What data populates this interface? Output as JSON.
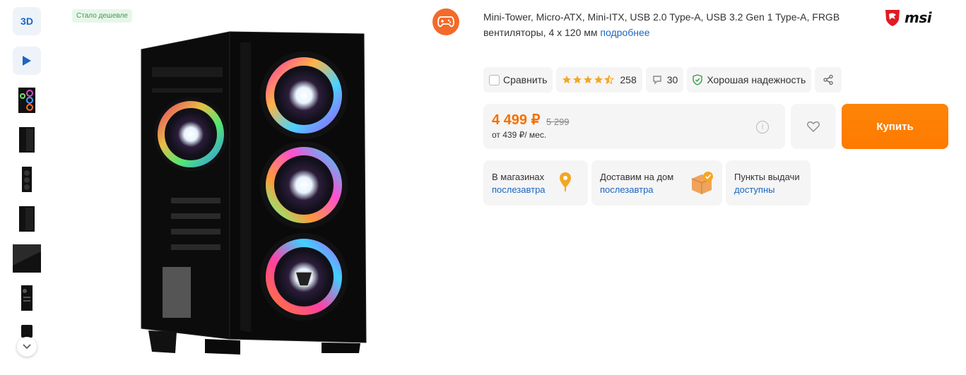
{
  "rail": {
    "btn_3d": "3D",
    "thumbs": [
      "thumb-1",
      "thumb-2",
      "thumb-3",
      "thumb-4",
      "thumb-5",
      "thumb-6",
      "thumb-7"
    ]
  },
  "badge": "Стало дешевле",
  "description": {
    "text": "Mini-Tower, Micro-ATX, Mini-ITX, USB 2.0 Type-A, USB 3.2 Gen 1 Type-A, FRGB вентиляторы, 4 x 120 мм ",
    "more_link": "подробнее"
  },
  "brand": "msi",
  "chips": {
    "compare": "Сравнить",
    "rating_count": "258",
    "reviews_count": "30",
    "reliability": "Хорошая надежность",
    "rating_value": 4.5
  },
  "price": {
    "current": "4 499 ₽",
    "old": "5 299",
    "credit": "от 439 ₽/ мес."
  },
  "buy_label": "Купить",
  "availability": [
    {
      "title": "В магазинах",
      "value": "послезавтра"
    },
    {
      "title": "Доставим на дом",
      "value": "послезавтра"
    },
    {
      "title": "Пункты выдачи",
      "value": "доступны"
    }
  ],
  "colors": {
    "accent_orange": "#f56f00",
    "buy_button": "#ff7a00",
    "link_blue": "#1a66c2",
    "chip_bg": "#f5f5f5"
  }
}
